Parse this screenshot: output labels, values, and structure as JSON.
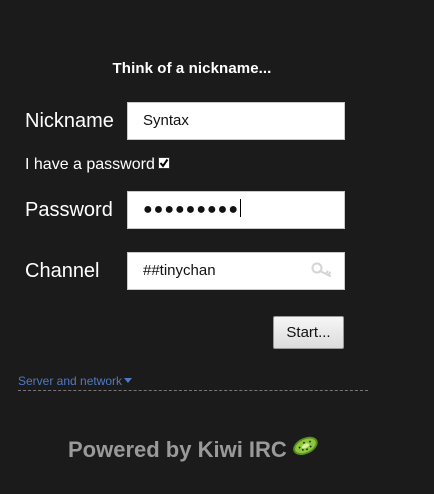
{
  "heading": "Think of a nickname...",
  "nickname": {
    "label": "Nickname",
    "value": "Syntax"
  },
  "password_toggle": {
    "label": "I have a password",
    "checked": true
  },
  "password": {
    "label": "Password",
    "masked_value": "●●●●●●●●●"
  },
  "channel": {
    "label": "Channel",
    "value": "##tinychan",
    "icon": "key-icon"
  },
  "start_button": "Start...",
  "server_link": "Server and network",
  "footer": {
    "powered_by": "Powered by Kiwi IRC",
    "logo": "kiwi-slice-logo"
  },
  "colors": {
    "background": "#1b1b1b",
    "link": "#4f79c5",
    "footer_text": "#9a9a9a",
    "kiwi_green": "#8dc63f"
  }
}
